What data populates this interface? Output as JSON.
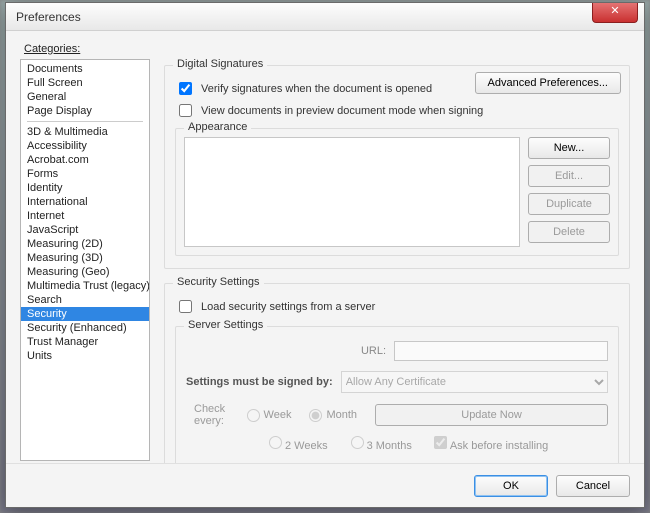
{
  "window": {
    "title": "Preferences"
  },
  "categories_label": "Categories:",
  "sidebar": {
    "group1": [
      "Documents",
      "Full Screen",
      "General",
      "Page Display"
    ],
    "group2": [
      "3D & Multimedia",
      "Accessibility",
      "Acrobat.com",
      "Forms",
      "Identity",
      "International",
      "Internet",
      "JavaScript",
      "Measuring (2D)",
      "Measuring (3D)",
      "Measuring (Geo)",
      "Multimedia Trust (legacy)",
      "Search",
      "Security",
      "Security (Enhanced)",
      "Trust Manager",
      "Units"
    ],
    "selected": "Security"
  },
  "digital_signatures": {
    "heading": "Digital Signatures",
    "verify_label": "Verify signatures when the document is opened",
    "verify_checked": true,
    "preview_label": "View documents in preview document mode when signing",
    "preview_checked": false,
    "advanced_btn": "Advanced Preferences...",
    "appearance_label": "Appearance",
    "buttons": {
      "new": "New...",
      "edit": "Edit...",
      "duplicate": "Duplicate",
      "delete": "Delete"
    }
  },
  "security_settings": {
    "heading": "Security Settings",
    "load_label": "Load security settings from a server",
    "load_checked": false,
    "server_settings_label": "Server Settings",
    "url_label": "URL:",
    "url_value": "",
    "signed_by_label": "Settings must be signed by:",
    "signed_by_value": "Allow Any Certificate",
    "check_every_label": "Check every:",
    "options": {
      "week": "Week",
      "month": "Month",
      "two_weeks": "2 Weeks",
      "three_months": "3 Months"
    },
    "selected_interval": "month",
    "ask_label": "Ask before installing",
    "ask_checked": true,
    "update_btn": "Update Now"
  },
  "footer": {
    "ok": "OK",
    "cancel": "Cancel"
  }
}
